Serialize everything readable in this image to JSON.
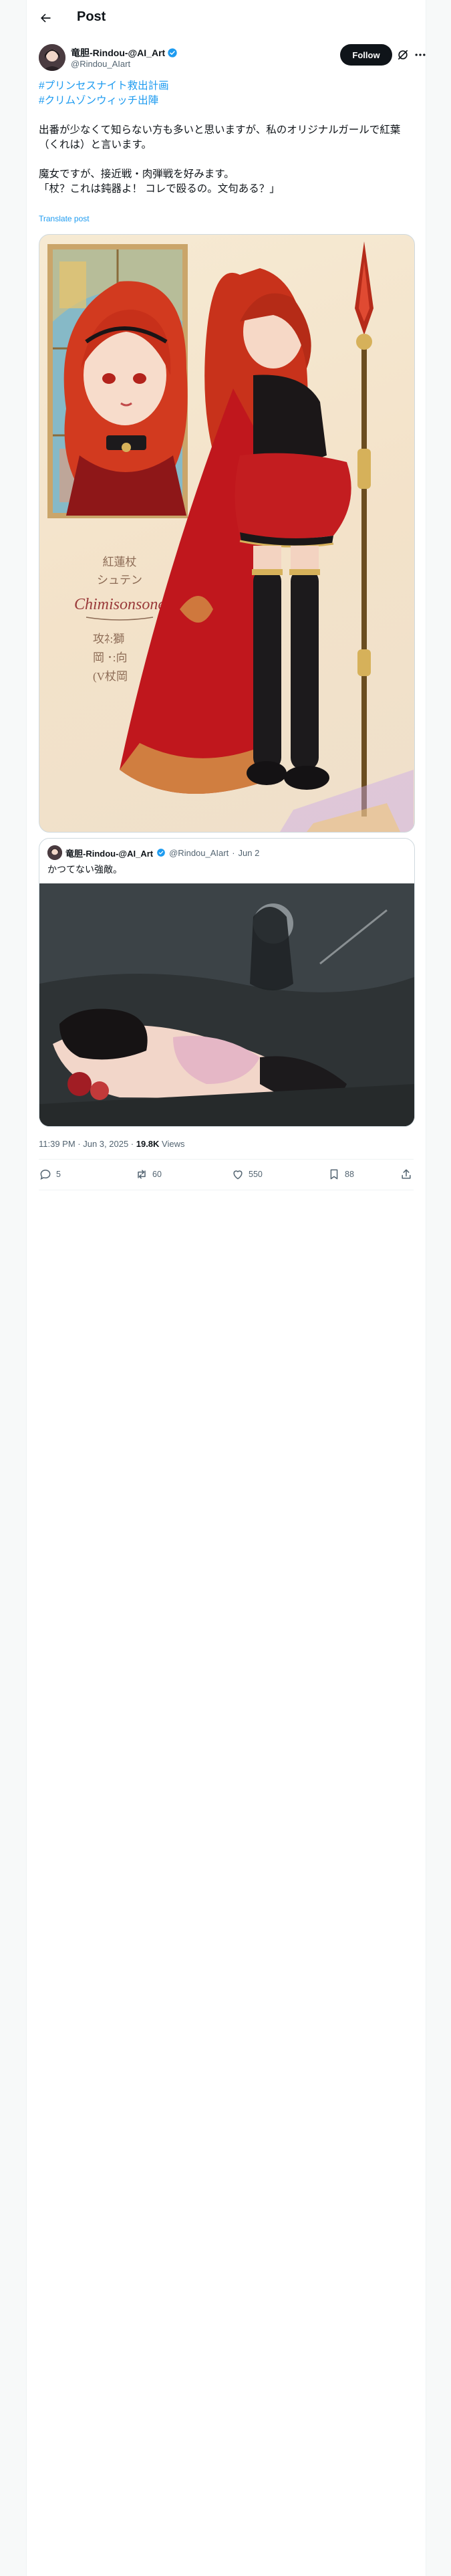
{
  "header": {
    "title": "Post"
  },
  "author": {
    "name": "竜胆-Rindou-@AI_Art",
    "handle": "@Rindou_AIart",
    "follow_label": "Follow"
  },
  "post": {
    "hashtags": [
      "#プリンセスナイト救出計画",
      "#クリムゾンウィッチ出陣"
    ],
    "paragraphs": [
      "出番が少なくて知らない方も多いと思いますが、私のオリジナルガールで紅葉（くれは）と言います。",
      "魔女ですが、接近戦・肉弾戦を好みます。",
      "「杖？これは鈍器よ！ コレで殴るの。文句ある？」"
    ],
    "translate_label": "Translate post"
  },
  "image_overlay": {
    "line1": "紅蓮杖",
    "line2": "シュテン",
    "script": "Chimisonsone",
    "line3": "攻ﾈ:獅",
    "line4": "岡 ･:向",
    "line5": "(V杖岡"
  },
  "quote": {
    "name": "竜胆-Rindou-@AI_Art",
    "handle": "@Rindou_AIart",
    "date": "Jun 2",
    "text": "かつてない強敵。"
  },
  "meta": {
    "time": "11:39 PM · Jun 3, 2025 · ",
    "views_count": "19.8K",
    "views_label": " Views"
  },
  "actions": {
    "replies": "5",
    "reposts": "60",
    "likes": "550",
    "bookmarks": "88"
  },
  "colors": {
    "accent": "#1d9bf0",
    "verified": "#1d9bf0",
    "text": "#0f1419",
    "muted": "#536471"
  }
}
